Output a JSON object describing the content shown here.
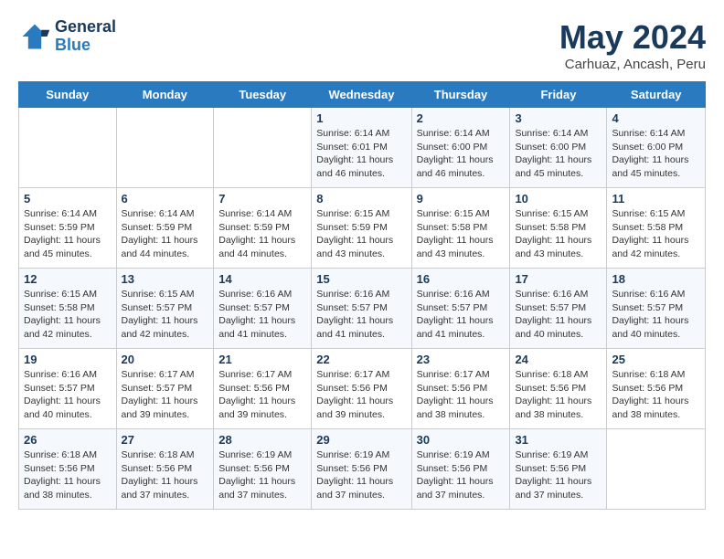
{
  "header": {
    "logo_line1": "General",
    "logo_line2": "Blue",
    "month": "May 2024",
    "location": "Carhuaz, Ancash, Peru"
  },
  "weekdays": [
    "Sunday",
    "Monday",
    "Tuesday",
    "Wednesday",
    "Thursday",
    "Friday",
    "Saturday"
  ],
  "weeks": [
    [
      {
        "day": "",
        "info": ""
      },
      {
        "day": "",
        "info": ""
      },
      {
        "day": "",
        "info": ""
      },
      {
        "day": "1",
        "info": "Sunrise: 6:14 AM\nSunset: 6:01 PM\nDaylight: 11 hours\nand 46 minutes."
      },
      {
        "day": "2",
        "info": "Sunrise: 6:14 AM\nSunset: 6:00 PM\nDaylight: 11 hours\nand 46 minutes."
      },
      {
        "day": "3",
        "info": "Sunrise: 6:14 AM\nSunset: 6:00 PM\nDaylight: 11 hours\nand 45 minutes."
      },
      {
        "day": "4",
        "info": "Sunrise: 6:14 AM\nSunset: 6:00 PM\nDaylight: 11 hours\nand 45 minutes."
      }
    ],
    [
      {
        "day": "5",
        "info": "Sunrise: 6:14 AM\nSunset: 5:59 PM\nDaylight: 11 hours\nand 45 minutes."
      },
      {
        "day": "6",
        "info": "Sunrise: 6:14 AM\nSunset: 5:59 PM\nDaylight: 11 hours\nand 44 minutes."
      },
      {
        "day": "7",
        "info": "Sunrise: 6:14 AM\nSunset: 5:59 PM\nDaylight: 11 hours\nand 44 minutes."
      },
      {
        "day": "8",
        "info": "Sunrise: 6:15 AM\nSunset: 5:59 PM\nDaylight: 11 hours\nand 43 minutes."
      },
      {
        "day": "9",
        "info": "Sunrise: 6:15 AM\nSunset: 5:58 PM\nDaylight: 11 hours\nand 43 minutes."
      },
      {
        "day": "10",
        "info": "Sunrise: 6:15 AM\nSunset: 5:58 PM\nDaylight: 11 hours\nand 43 minutes."
      },
      {
        "day": "11",
        "info": "Sunrise: 6:15 AM\nSunset: 5:58 PM\nDaylight: 11 hours\nand 42 minutes."
      }
    ],
    [
      {
        "day": "12",
        "info": "Sunrise: 6:15 AM\nSunset: 5:58 PM\nDaylight: 11 hours\nand 42 minutes."
      },
      {
        "day": "13",
        "info": "Sunrise: 6:15 AM\nSunset: 5:57 PM\nDaylight: 11 hours\nand 42 minutes."
      },
      {
        "day": "14",
        "info": "Sunrise: 6:16 AM\nSunset: 5:57 PM\nDaylight: 11 hours\nand 41 minutes."
      },
      {
        "day": "15",
        "info": "Sunrise: 6:16 AM\nSunset: 5:57 PM\nDaylight: 11 hours\nand 41 minutes."
      },
      {
        "day": "16",
        "info": "Sunrise: 6:16 AM\nSunset: 5:57 PM\nDaylight: 11 hours\nand 41 minutes."
      },
      {
        "day": "17",
        "info": "Sunrise: 6:16 AM\nSunset: 5:57 PM\nDaylight: 11 hours\nand 40 minutes."
      },
      {
        "day": "18",
        "info": "Sunrise: 6:16 AM\nSunset: 5:57 PM\nDaylight: 11 hours\nand 40 minutes."
      }
    ],
    [
      {
        "day": "19",
        "info": "Sunrise: 6:16 AM\nSunset: 5:57 PM\nDaylight: 11 hours\nand 40 minutes."
      },
      {
        "day": "20",
        "info": "Sunrise: 6:17 AM\nSunset: 5:57 PM\nDaylight: 11 hours\nand 39 minutes."
      },
      {
        "day": "21",
        "info": "Sunrise: 6:17 AM\nSunset: 5:56 PM\nDaylight: 11 hours\nand 39 minutes."
      },
      {
        "day": "22",
        "info": "Sunrise: 6:17 AM\nSunset: 5:56 PM\nDaylight: 11 hours\nand 39 minutes."
      },
      {
        "day": "23",
        "info": "Sunrise: 6:17 AM\nSunset: 5:56 PM\nDaylight: 11 hours\nand 38 minutes."
      },
      {
        "day": "24",
        "info": "Sunrise: 6:18 AM\nSunset: 5:56 PM\nDaylight: 11 hours\nand 38 minutes."
      },
      {
        "day": "25",
        "info": "Sunrise: 6:18 AM\nSunset: 5:56 PM\nDaylight: 11 hours\nand 38 minutes."
      }
    ],
    [
      {
        "day": "26",
        "info": "Sunrise: 6:18 AM\nSunset: 5:56 PM\nDaylight: 11 hours\nand 38 minutes."
      },
      {
        "day": "27",
        "info": "Sunrise: 6:18 AM\nSunset: 5:56 PM\nDaylight: 11 hours\nand 37 minutes."
      },
      {
        "day": "28",
        "info": "Sunrise: 6:19 AM\nSunset: 5:56 PM\nDaylight: 11 hours\nand 37 minutes."
      },
      {
        "day": "29",
        "info": "Sunrise: 6:19 AM\nSunset: 5:56 PM\nDaylight: 11 hours\nand 37 minutes."
      },
      {
        "day": "30",
        "info": "Sunrise: 6:19 AM\nSunset: 5:56 PM\nDaylight: 11 hours\nand 37 minutes."
      },
      {
        "day": "31",
        "info": "Sunrise: 6:19 AM\nSunset: 5:56 PM\nDaylight: 11 hours\nand 37 minutes."
      },
      {
        "day": "",
        "info": ""
      }
    ]
  ]
}
